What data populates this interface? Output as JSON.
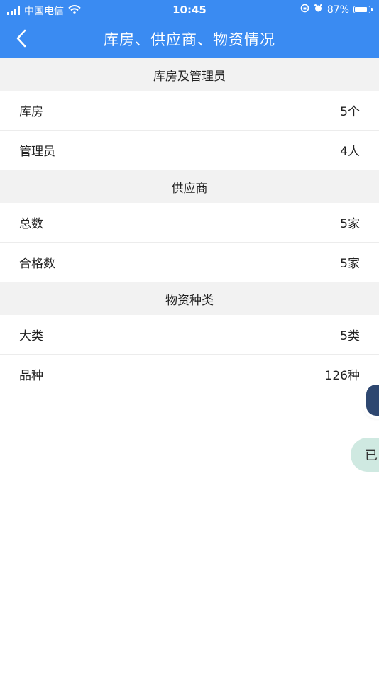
{
  "status_bar": {
    "carrier": "中国电信",
    "time": "10:45",
    "battery": "87%",
    "icons": [
      "signal-icon",
      "wifi-icon",
      "rotation-lock-icon",
      "alarm-icon",
      "battery-icon"
    ],
    "battery_level": 0.87
  },
  "navbar": {
    "back_icon": "chevron-left-icon",
    "title": "库房、供应商、物资情况",
    "background": "#3a8bf2"
  },
  "sections": [
    {
      "title": "库房及管理员",
      "rows": [
        {
          "label": "库房",
          "value": "5个"
        },
        {
          "label": "管理员",
          "value": "4人"
        }
      ]
    },
    {
      "title": "供应商",
      "rows": [
        {
          "label": "总数",
          "value": "5家"
        },
        {
          "label": "合格数",
          "value": "5家"
        }
      ]
    },
    {
      "title": "物资种类",
      "rows": [
        {
          "label": "大类",
          "value": "5类"
        },
        {
          "label": "品种",
          "value": "126种"
        }
      ]
    }
  ],
  "floating": {
    "pill_text": "已",
    "pill_color": "#cfe9e1",
    "avatar_color": "#2e4770"
  }
}
